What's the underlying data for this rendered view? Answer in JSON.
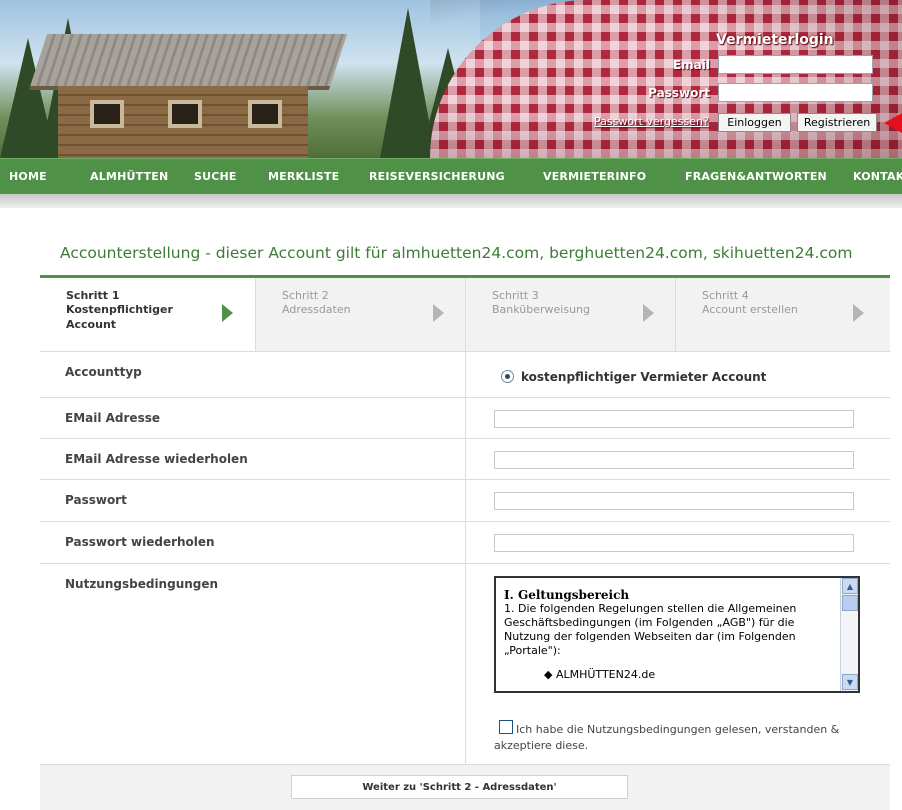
{
  "login": {
    "title": "Vermieterlogin",
    "email_label": "Email",
    "password_label": "Passwort",
    "forgot_link": "Passwort vergessen?",
    "login_button": "Einloggen",
    "register_button": "Registrieren"
  },
  "nav": {
    "items": [
      "HOME",
      "ALMHÜTTEN",
      "SUCHE",
      "MERKLISTE",
      "REISEVERSICHERUNG",
      "VERMIETERINFO",
      "FRAGEN&ANTWORTEN",
      "KONTAKT"
    ]
  },
  "page": {
    "title": "Accounterstellung - dieser Account gilt für almhuetten24.com, berghuetten24.com, skihuetten24.com"
  },
  "steps": [
    {
      "number": "Schritt 1",
      "line1": "Kostenpflichtiger",
      "line2": "Account",
      "active": true
    },
    {
      "number": "Schritt 2",
      "line1": "Adressdaten",
      "line2": "",
      "active": false
    },
    {
      "number": "Schritt 3",
      "line1": "Banküberweisung",
      "line2": "",
      "active": false
    },
    {
      "number": "Schritt 4",
      "line1": "Account erstellen",
      "line2": "",
      "active": false
    }
  ],
  "form": {
    "account_type_label": "Accounttyp",
    "account_type_option": "kostenpflichtiger Vermieter Account",
    "email_label": "EMail Adresse",
    "email_repeat_label": "EMail Adresse wiederholen",
    "password_label": "Passwort",
    "password_repeat_label": "Passwort wiederholen",
    "terms_label": "Nutzungsbedingungen",
    "terms_heading": "I. Geltungsbereich",
    "terms_text": "1. Die folgenden Regelungen stellen die Allgemeinen Geschäftsbedingungen (im Folgenden „AGB\") für die Nutzung der folgenden Webseiten dar (im Folgenden „Portale\"):",
    "terms_bullet": "ALMHÜTTEN24.de",
    "accept_label": "Ich habe die Nutzungsbedingungen gelesen, verstanden & akzeptiere diese.",
    "next_button": "Weiter zu 'Schritt 2 - Adressdaten'"
  }
}
